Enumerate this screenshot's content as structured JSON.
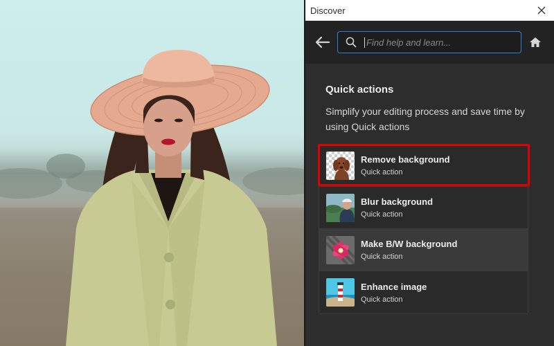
{
  "panel": {
    "title": "Discover",
    "search": {
      "placeholder": "Find help and learn..."
    },
    "section": {
      "title": "Quick actions",
      "description": "Simplify your editing process and save time by using Quick actions"
    },
    "actions": [
      {
        "name": "Remove background",
        "subtitle": "Quick action",
        "thumb": "dog-on-transparency"
      },
      {
        "name": "Blur background",
        "subtitle": "Quick action",
        "thumb": "man-blurred-landscape"
      },
      {
        "name": "Make B/W background",
        "subtitle": "Quick action",
        "thumb": "pink-flower-gray-background"
      },
      {
        "name": "Enhance image",
        "subtitle": "Quick action",
        "thumb": "lighthouse-seascape"
      }
    ]
  },
  "colors": {
    "accent_blue": "#2f80d6",
    "highlight_red": "#e00000",
    "panel_bg": "#2d2d2d"
  }
}
